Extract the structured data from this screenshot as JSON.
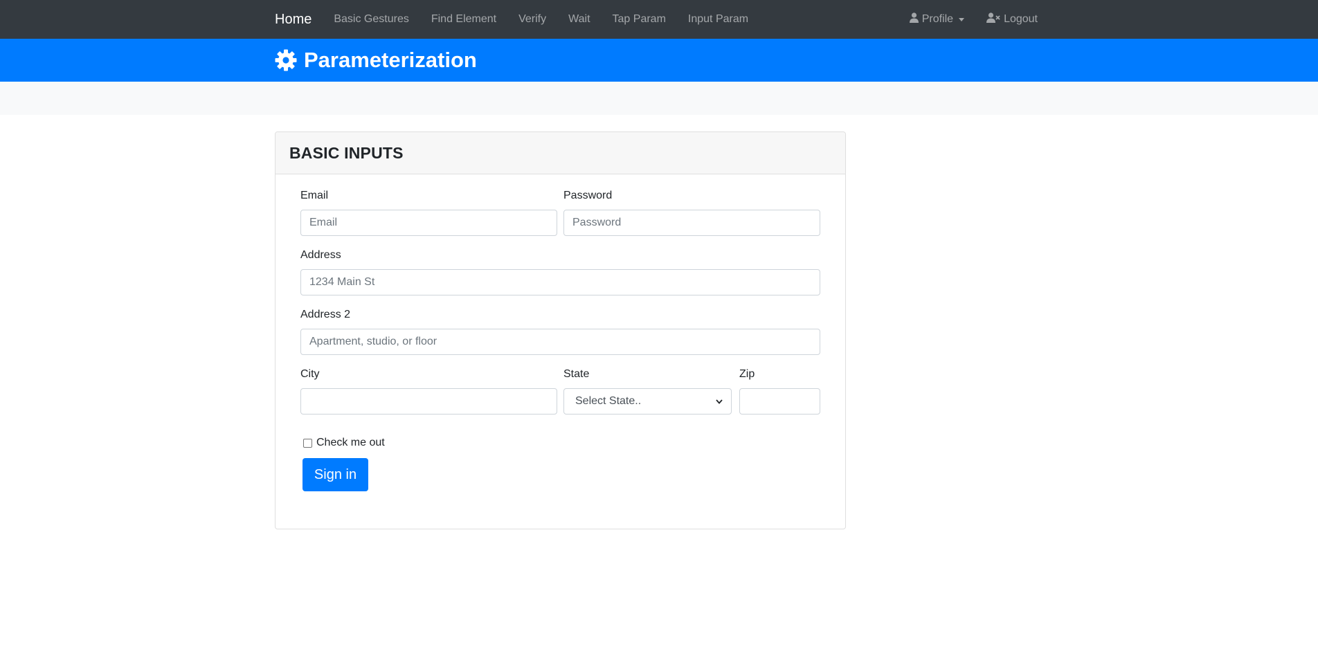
{
  "navbar": {
    "brand": "Home",
    "links": [
      "Basic Gestures",
      "Find Element",
      "Verify",
      "Wait",
      "Tap Param",
      "Input Param"
    ],
    "profile_label": "Profile",
    "logout_label": "Logout"
  },
  "header": {
    "title": "Parameterization",
    "icon": "gear-icon"
  },
  "card": {
    "title": "BASIC INPUTS",
    "email": {
      "label": "Email",
      "placeholder": "Email",
      "value": ""
    },
    "password": {
      "label": "Password",
      "placeholder": "Password",
      "value": ""
    },
    "address": {
      "label": "Address",
      "placeholder": "1234 Main St",
      "value": ""
    },
    "address2": {
      "label": "Address 2",
      "placeholder": "Apartment, studio, or floor",
      "value": ""
    },
    "city": {
      "label": "City",
      "placeholder": "",
      "value": ""
    },
    "state": {
      "label": "State",
      "selected": "Select State.."
    },
    "zip": {
      "label": "Zip",
      "placeholder": "",
      "value": ""
    },
    "checkbox_label": "Check me out",
    "checkbox_checked": false,
    "submit_label": "Sign in"
  },
  "colors": {
    "navbar_bg": "#343a40",
    "primary": "#007bff",
    "strip_bg": "#f8f9fa"
  }
}
